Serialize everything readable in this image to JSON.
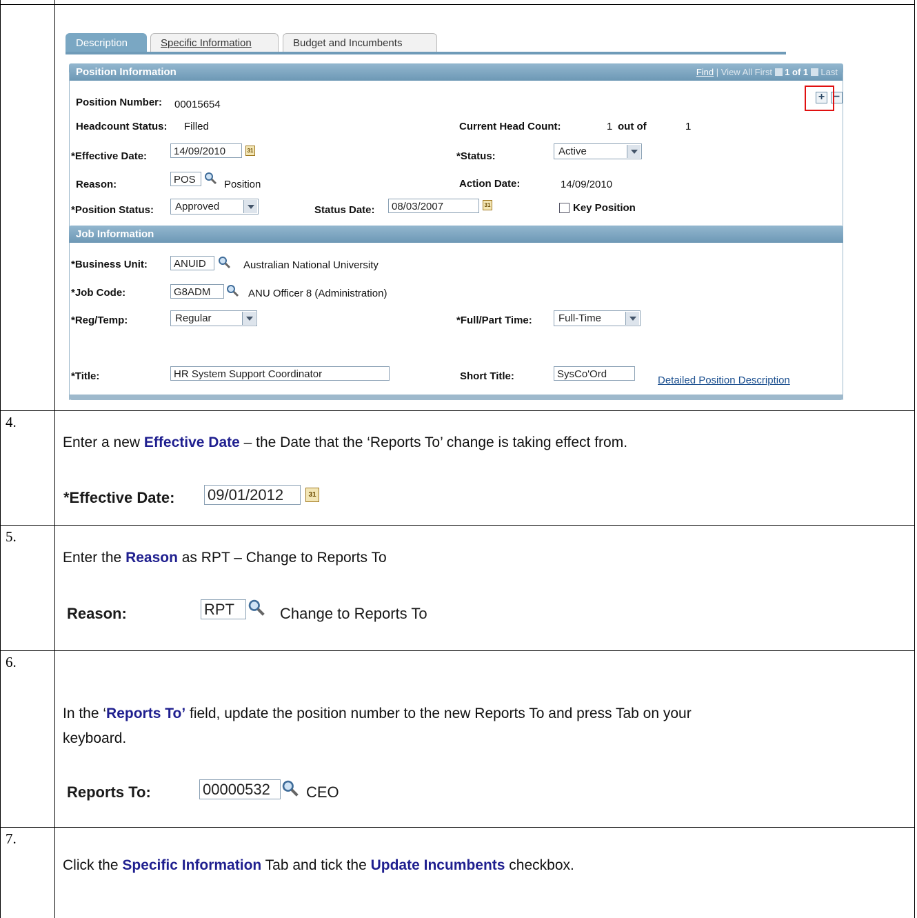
{
  "tabs": {
    "description": "Description",
    "specific": "Specific Information",
    "budget": "Budget and Incumbents"
  },
  "position_info": {
    "header": "Position Information",
    "pager": {
      "find": "Find",
      "sep": "|",
      "view_all": "View All",
      "first": "First",
      "count": "1 of 1",
      "last": "Last"
    },
    "add_row": "+",
    "delete_row": "−",
    "position_number_label": "Position Number:",
    "position_number": "00015654",
    "headcount_status_label": "Headcount Status:",
    "headcount_status": "Filled",
    "current_head_count_label": "Current Head Count:",
    "current_head_count": "1",
    "out_of": "out of",
    "max_head_count": "1",
    "effective_date_label": "*Effective Date:",
    "effective_date": "14/09/2010",
    "status_label": "*Status:",
    "status": "Active",
    "reason_label": "Reason:",
    "reason_code": "POS",
    "reason_desc": "Position",
    "action_date_label": "Action Date:",
    "action_date": "14/09/2010",
    "position_status_label": "*Position Status:",
    "position_status": "Approved",
    "status_date_label": "Status Date:",
    "status_date": "08/03/2007",
    "key_position_label": "Key Position",
    "calendar_glyph": "31"
  },
  "job_info": {
    "header": "Job Information",
    "business_unit_label": "*Business Unit:",
    "business_unit": "ANUID",
    "business_unit_desc": "Australian National University",
    "job_code_label": "*Job Code:",
    "job_code": "G8ADM",
    "job_code_desc": "ANU Officer 8 (Administration)",
    "reg_temp_label": "*Reg/Temp:",
    "reg_temp": "Regular",
    "full_part_label": "*Full/Part Time:",
    "full_part": "Full-Time",
    "title_label": "*Title:",
    "title": "HR System Support Coordinator",
    "short_title_label": "Short Title:",
    "short_title": "SysCo'Ord",
    "detailed_link": "Detailed Position Description"
  },
  "steps": [
    {
      "num": "4.",
      "pre": "Enter a new ",
      "bold": "Effective Date",
      "post": " – the Date that the ‘Reports To’ change is taking effect from.",
      "ex_label": "*Effective Date:",
      "ex_value": "09/01/2012"
    },
    {
      "num": "5.",
      "pre": "Enter the ",
      "bold": "Reason",
      "post": " as RPT – Change to Reports To",
      "ex_label": "Reason:",
      "ex_value": "RPT",
      "ex_desc": "Change to Reports To"
    },
    {
      "num": "6.",
      "pre": "In the ‘",
      "bold": "Reports To’",
      "post": " field, update the position number to the new Reports To and press Tab on your",
      "line2": "keyboard.",
      "ex_label": "Reports To:",
      "ex_value": "00000532",
      "ex_desc": "CEO"
    },
    {
      "num": "7.",
      "pre": "Click the ",
      "bold": "Specific Information",
      "mid": " Tab and tick the ",
      "bold2": "Update Incumbents",
      "post": " checkbox."
    }
  ]
}
